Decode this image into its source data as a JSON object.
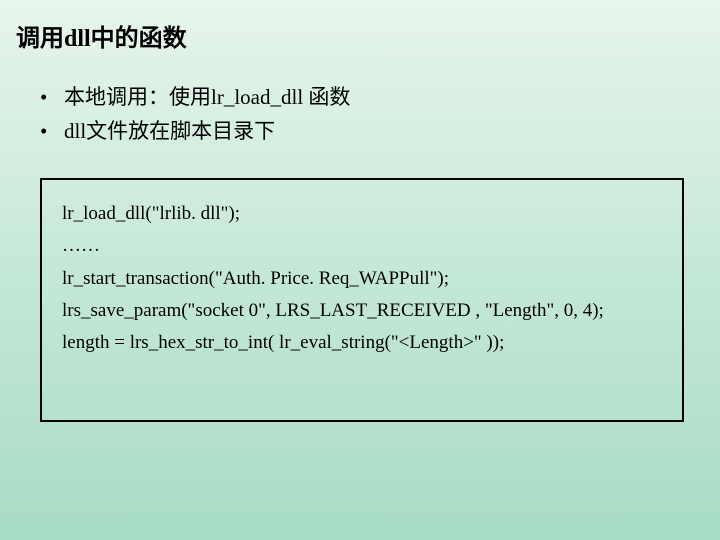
{
  "title": "调用dll中的函数",
  "bullets": [
    "本地调用：使用lr_load_dll 函数",
    "dll文件放在脚本目录下"
  ],
  "code": {
    "lines": [
      "lr_load_dll(\"lrlib. dll\");",
      "……",
      "lr_start_transaction(\"Auth. Price. Req_WAPPull\");",
      "lrs_save_param(\"socket 0\", LRS_LAST_RECEIVED , \"Length\", 0, 4);",
      "length = lrs_hex_str_to_int( lr_eval_string(\"<Length>\" ));"
    ]
  }
}
